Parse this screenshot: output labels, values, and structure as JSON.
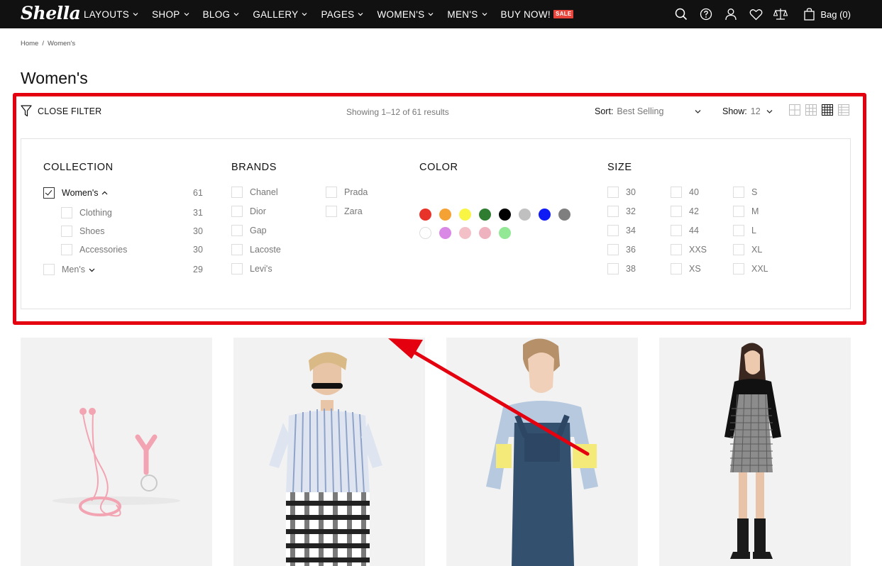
{
  "header": {
    "logo": "Shella",
    "nav": [
      {
        "label": "LAYOUTS"
      },
      {
        "label": "SHOP"
      },
      {
        "label": "BLOG"
      },
      {
        "label": "GALLERY"
      },
      {
        "label": "PAGES"
      },
      {
        "label": "WOMEN'S"
      },
      {
        "label": "MEN'S"
      },
      {
        "label": "BUY NOW!"
      }
    ],
    "sale_badge": "SALE",
    "bag_label": "Bag (0)",
    "icons": [
      "search-icon",
      "help-icon",
      "account-icon",
      "wishlist-icon",
      "compare-icon",
      "bag-icon"
    ]
  },
  "breadcrumb": {
    "home": "Home",
    "separator": "/",
    "current": "Women's"
  },
  "page_title": "Women's",
  "toolbar": {
    "close_filter": "CLOSE FILTER",
    "showing": "Showing 1–12 of 61 results",
    "sort_label": "Sort:",
    "sort_value": "Best Selling",
    "show_label": "Show:",
    "show_value": "12",
    "grid_views": [
      "grid-2-icon",
      "grid-3-icon",
      "grid-4-icon",
      "list-view-icon"
    ],
    "active_grid": "grid-4-icon"
  },
  "filters": {
    "collection": {
      "title": "COLLECTION",
      "items": [
        {
          "label": "Women's",
          "count": "61",
          "checked": true
        },
        {
          "label": "Clothing",
          "count": "31",
          "checked": false
        },
        {
          "label": "Shoes",
          "count": "30",
          "checked": false
        },
        {
          "label": "Accessories",
          "count": "30",
          "checked": false
        },
        {
          "label": "Men's",
          "count": "29",
          "checked": false
        }
      ]
    },
    "brands": {
      "title": "BRANDS",
      "items": [
        {
          "label": "Chanel"
        },
        {
          "label": "Dior"
        },
        {
          "label": "Gap"
        },
        {
          "label": "Lacoste"
        },
        {
          "label": "Levi's"
        },
        {
          "label": "Prada"
        },
        {
          "label": "Zara"
        }
      ]
    },
    "color": {
      "title": "COLOR",
      "swatches": [
        "#e8332a",
        "#f3a233",
        "#f8f545",
        "#2f7d31",
        "#000000",
        "#c0c0c0",
        "#0f1bf5",
        "#7f7f7f",
        "#ffffff",
        "#da88e6",
        "#f4c0c8",
        "#efb3bf",
        "#93e895"
      ]
    },
    "size": {
      "title": "SIZE",
      "items": [
        {
          "label": "30"
        },
        {
          "label": "32"
        },
        {
          "label": "34"
        },
        {
          "label": "36"
        },
        {
          "label": "38"
        },
        {
          "label": "40"
        },
        {
          "label": "42"
        },
        {
          "label": "44"
        },
        {
          "label": "XXS"
        },
        {
          "label": "XS"
        },
        {
          "label": "S"
        },
        {
          "label": "M"
        },
        {
          "label": "L"
        },
        {
          "label": "XL"
        },
        {
          "label": "XXL"
        }
      ]
    }
  },
  "annotation_color": "#e4000f",
  "products": [
    {
      "name": "product-earphones"
    },
    {
      "name": "product-striped-shirt"
    },
    {
      "name": "product-denim-overalls"
    },
    {
      "name": "product-checked-pinafore-dress"
    }
  ]
}
